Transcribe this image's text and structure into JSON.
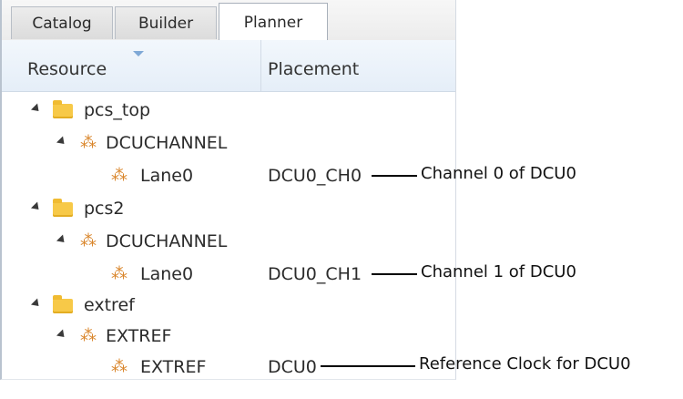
{
  "tabs": [
    "Catalog",
    "Builder",
    "Planner"
  ],
  "columns": {
    "resource": "Resource",
    "placement": "Placement"
  },
  "tree": {
    "pcs_top": {
      "label": "pcs_top",
      "channel": "DCUCHANNEL",
      "lane": {
        "label": "Lane0",
        "placement": "DCU0_CH0",
        "note": "Channel 0 of DCU0"
      }
    },
    "pcs2": {
      "label": "pcs2",
      "channel": "DCUCHANNEL",
      "lane": {
        "label": "Lane0",
        "placement": "DCU0_CH1",
        "note": "Channel 1 of DCU0"
      }
    },
    "extref": {
      "label": "extref",
      "channel": "EXTREF",
      "lane": {
        "label": "EXTREF",
        "placement": "DCU0",
        "note": "Reference Clock for DCU0"
      }
    }
  },
  "icons": {
    "folder": "folder-icon",
    "component": "component-icon",
    "expander": "expander-icon"
  },
  "colors": {
    "folder": "#f7c948",
    "component": "#d9852a",
    "header": "#e5eef8"
  }
}
